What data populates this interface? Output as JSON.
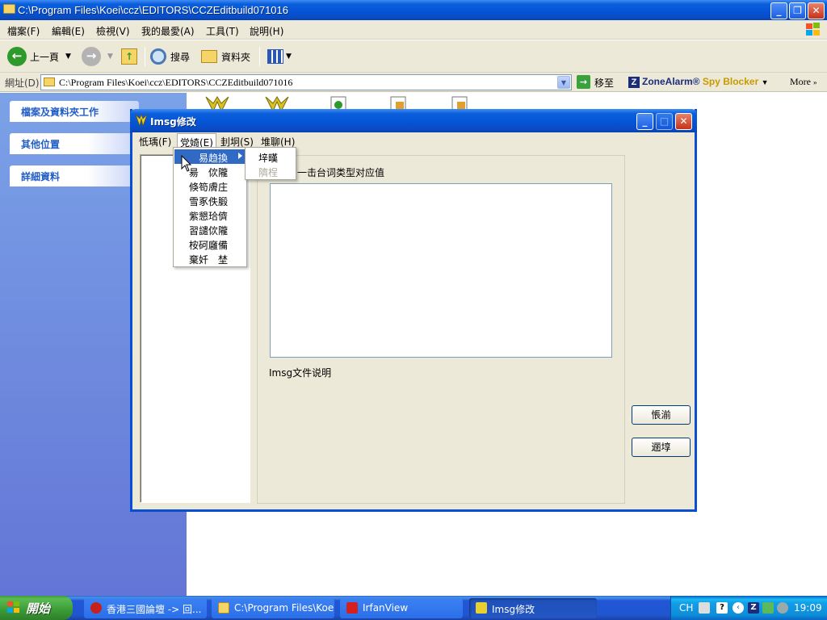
{
  "explorer": {
    "title": "C:\\Program Files\\Koei\\ccz\\EDITORS\\CCZEditbuild071016",
    "menu": [
      "檔案(F)",
      "編輯(E)",
      "檢視(V)",
      "我的最愛(A)",
      "工具(T)",
      "說明(H)"
    ],
    "toolbar": {
      "back": "上一頁",
      "search": "搜尋",
      "folders": "資料夾"
    },
    "address": {
      "label": "網址(D)",
      "value": "C:\\Program Files\\Koei\\ccz\\EDITORS\\CCZEditbuild071016",
      "go": "移至",
      "zonealarm": "ZoneAlarm®",
      "spy_blocker": "Spy Blocker",
      "more": "More"
    },
    "taskpane": [
      "檔案及資料夾工作",
      "其他位置",
      "詳細資料"
    ]
  },
  "dialog": {
    "title": "Imsg修改",
    "menu": [
      "忯瑀(F)",
      "党婍(E)",
      "刲坰(S)",
      "堆聊(H)"
    ],
    "group_label": "一击台词类型对应值",
    "description": "Imsg文件说明",
    "buttons": [
      "悵湔",
      "逦埻"
    ]
  },
  "menu_open": {
    "items": [
      "易趋換",
      "昜　佽隴",
      "倏笱膚庄",
      "雪豖佚腶",
      "紫懇珨儕",
      "習譴佽隴",
      "桉砢廱備",
      "棄奷　埜"
    ],
    "submenu": [
      "垶暵",
      "隮桯"
    ]
  },
  "taskbar": {
    "start": "開始",
    "tasks": [
      "香港三國論壇 -> 回...",
      "C:\\Program Files\\Koei\\...",
      "IrfanView",
      "Imsg修改"
    ],
    "lang": "CH",
    "clock": "19:09"
  },
  "colors": {
    "xp_blue": "#0a5fdc",
    "menu_highlight": "#316ac5",
    "taskpane_link": "#215dc6",
    "start_green": "#3c9a3a"
  }
}
